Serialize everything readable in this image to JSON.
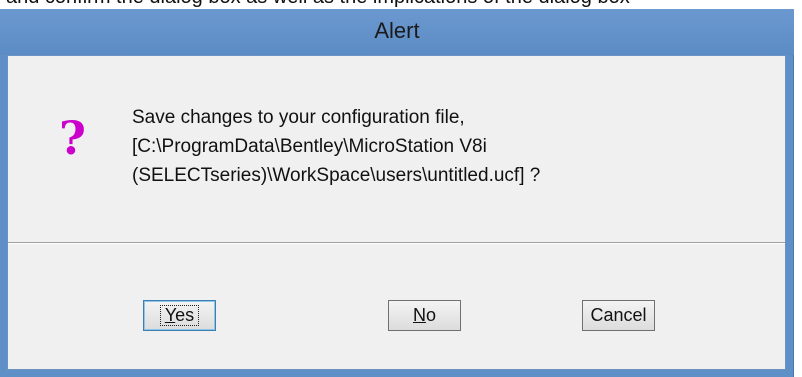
{
  "top_strip_text": "and confirm the dialog box as well as the implications of the dialog box",
  "window": {
    "title": "Alert"
  },
  "icon": {
    "name": "question-icon",
    "glyph": "?",
    "color": "#cc00cc"
  },
  "message": {
    "lines": [
      "Save changes to your configuration file,",
      "[C:\\ProgramData\\Bentley\\MicroStation V8i",
      "(SELECTseries)\\WorkSpace\\users\\untitled.ucf] ?"
    ]
  },
  "buttons": {
    "yes": {
      "mnemonic": "Y",
      "rest": "es"
    },
    "no": {
      "mnemonic": "N",
      "rest": "o"
    },
    "cancel": {
      "label": "Cancel"
    }
  },
  "colors": {
    "titlebar": "#5f8fc7",
    "client": "#f0f0f0"
  }
}
